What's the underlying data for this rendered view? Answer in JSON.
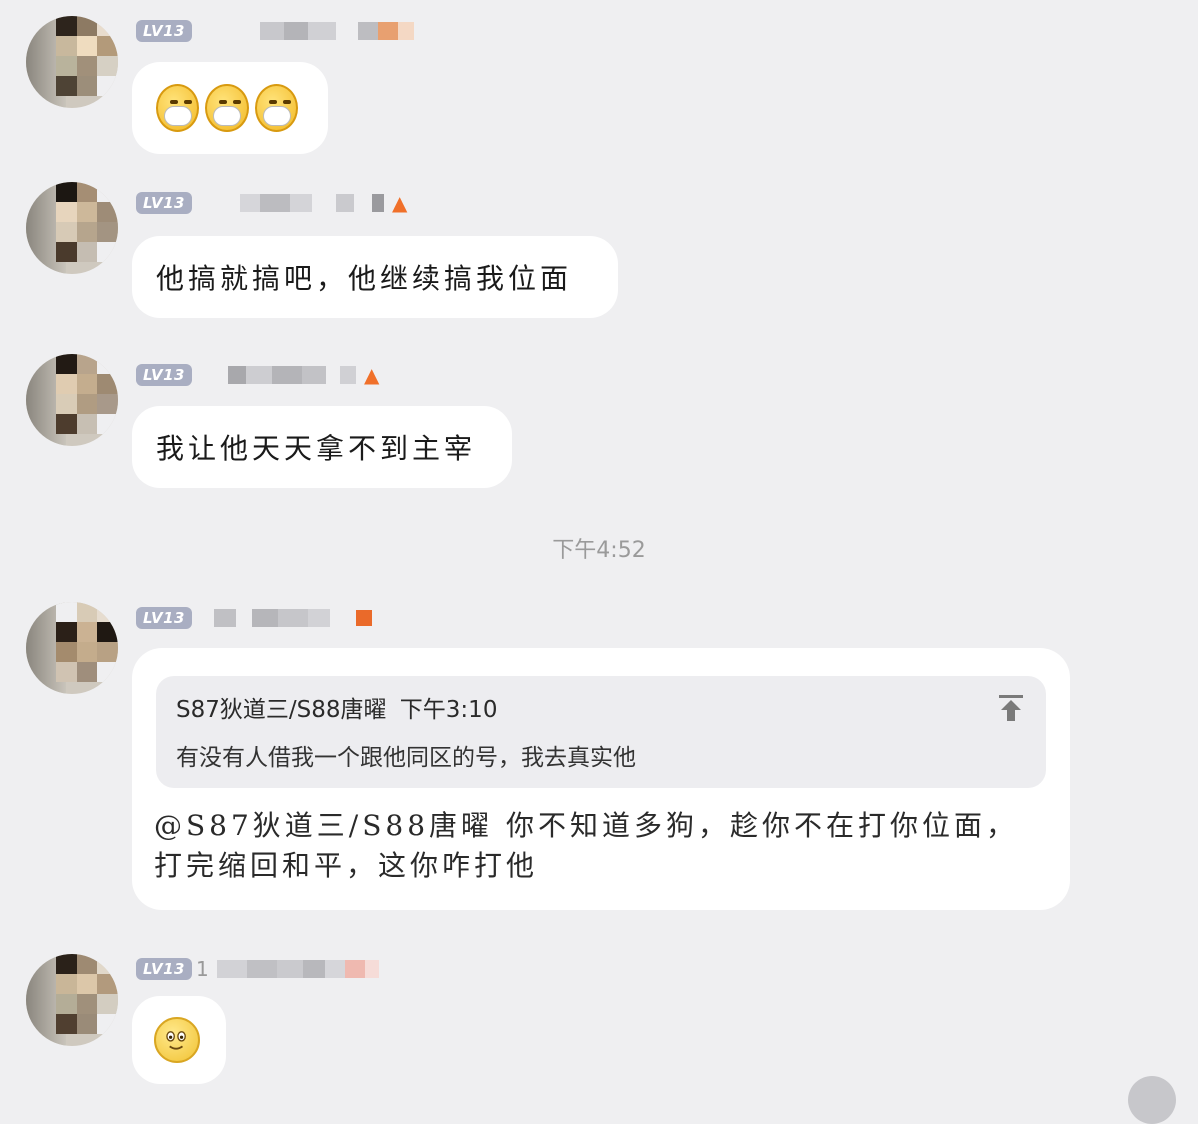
{
  "messages": [
    {
      "level": "LV13",
      "type": "emoji",
      "emoji": [
        "mask-face-emoji",
        "mask-face-emoji",
        "mask-face-emoji"
      ]
    },
    {
      "level": "LV13",
      "type": "text",
      "text": "他搞就搞吧，他继续搞我位面"
    },
    {
      "level": "LV13",
      "type": "text",
      "text": "我让他天天拿不到主宰"
    },
    {
      "level": "LV13",
      "type": "reply",
      "quote": {
        "author": "S87狄道三/S88唐曜",
        "time": "下午3:10",
        "text": "有没有人借我一个跟他同区的号，我去真实他"
      },
      "text": "@S87狄道三/S88唐曜 你不知道多狗，趁你不在打你位面，打完缩回和平，这你咋打他"
    },
    {
      "level": "LV13",
      "name_prefix": "1",
      "type": "emoji",
      "emoji": [
        "smile-emoji"
      ]
    }
  ],
  "timestamp": "下午4:52",
  "colors": {
    "background": "#efeff1",
    "bubble": "#ffffff",
    "level_badge": "#a9aec2",
    "flame": "#f0702a"
  }
}
